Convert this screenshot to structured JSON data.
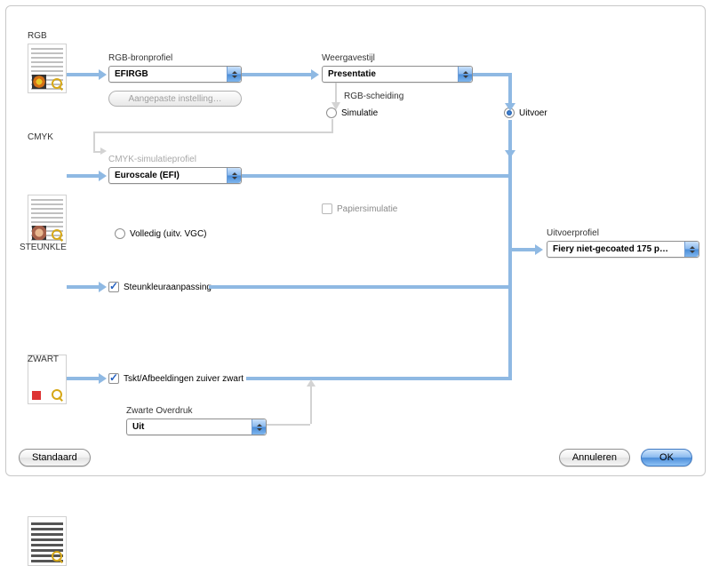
{
  "sections": {
    "rgb": "RGB",
    "cmyk": "CMYK",
    "spot": "STEUNKLE",
    "black": "ZWART"
  },
  "labels": {
    "rgb_source": "RGB-bronprofiel",
    "custom_setting": "Aangepaste instelling…",
    "rendering": "Weergavestijl",
    "rgb_separation": "RGB-scheiding",
    "simulation": "Simulatie",
    "output": "Uitvoer",
    "cmyk_sim": "CMYK-simulatieprofiel",
    "paper_sim": "Papiersimulatie",
    "full_vgc": "Volledig (uitv. VGC)",
    "spot_match": "Steunkleuraanpassing",
    "pure_black": "Tskt/Afbeeldingen zuiver zwart",
    "black_overprint": "Zwarte Overdruk",
    "output_profile": "Uitvoerprofiel"
  },
  "dropdowns": {
    "rgb_profile": "EFIRGB",
    "rendering": "Presentatie",
    "cmyk_profile": "Euroscale (EFI)",
    "black_overprint": "Uit",
    "output_profile": "Fiery niet-gecoated 175 p…"
  },
  "buttons": {
    "standard": "Standaard",
    "cancel": "Annuleren",
    "ok": "OK"
  },
  "radios": {
    "simulation": false,
    "output": true
  },
  "checks": {
    "paper_sim": false,
    "full_vgc": false,
    "spot_match": true,
    "pure_black": true
  }
}
